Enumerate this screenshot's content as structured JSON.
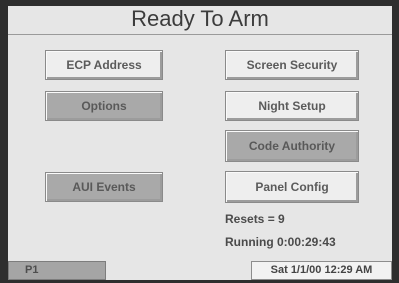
{
  "header": {
    "title": "Ready To Arm"
  },
  "menu": {
    "ecp_address": "ECP Address",
    "screen_security": "Screen Security",
    "options": "Options",
    "night_setup": "Night Setup",
    "code_authority": "Code Authority",
    "all_events": "AUI Events",
    "panel_config": "Panel Config"
  },
  "status": {
    "resets": "Resets = 9",
    "running": "Running 0:00:29:43"
  },
  "footer": {
    "page": "P1",
    "datetime": "Sat 1/1/00 12:29 AM"
  }
}
